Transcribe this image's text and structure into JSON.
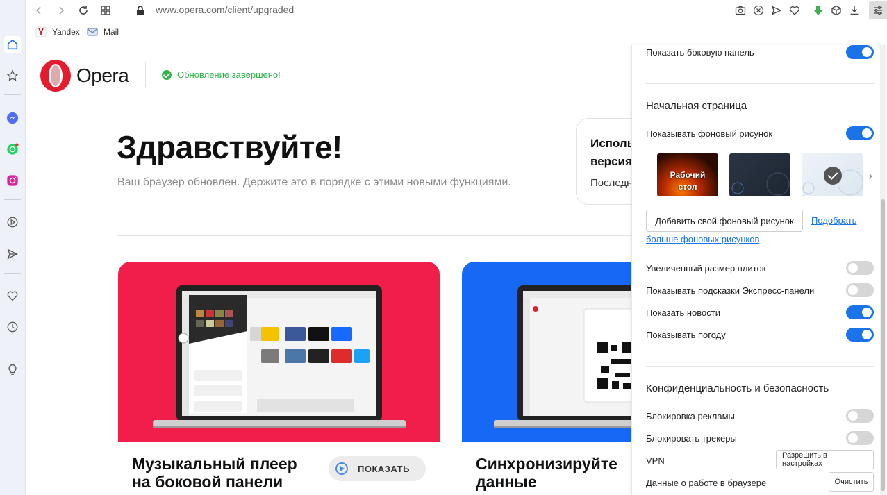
{
  "browser": {
    "url": "www.opera.com/client/upgraded",
    "bookmarks": [
      {
        "label": "Yandex"
      },
      {
        "label": "Mail"
      }
    ]
  },
  "page": {
    "logo_text": "Opera",
    "update_status": "Обновление завершено!",
    "heading": "Здравствуйте!",
    "subheading": "Ваш браузер обновлен. Держите это в порядке с этими новыми функциями.",
    "peek_card": {
      "line1": "Исполь",
      "line2": "версия",
      "line3": "Последн"
    },
    "cards": [
      {
        "title_line1": "Музыкальный плеер",
        "title_line2": "на боковой панели",
        "button": "ПОКАЗАТЬ",
        "color": "#f01e49"
      },
      {
        "title_line1": "Синхронизируйте",
        "title_line2": "данные",
        "color": "#1769f5"
      }
    ]
  },
  "settings": {
    "show_sidebar": {
      "label": "Показать боковую панель",
      "on": true
    },
    "start_page_title": "Начальная страница",
    "show_wallpaper": {
      "label": "Показывать фоновый рисунок",
      "on": true
    },
    "wallpapers": [
      {
        "label_line1": "Рабочий",
        "label_line2": "стол"
      }
    ],
    "add_wallpaper_btn": "Добавить свой фоновый рисунок",
    "more_link_part1": "Подобрать",
    "more_link_part2": "больше фоновых рисунков",
    "toggles": [
      {
        "label": "Увеличенный размер плиток",
        "on": false
      },
      {
        "label": "Показывать подсказки Экспресс-панели",
        "on": false
      },
      {
        "label": "Показать новости",
        "on": true
      },
      {
        "label": "Показывать погоду",
        "on": true
      }
    ],
    "privacy_title": "Конфиденциальность и безопасность",
    "privacy": [
      {
        "label": "Блокировка рекламы",
        "on": false
      },
      {
        "label": "Блокировать трекеры",
        "on": false
      }
    ],
    "vpn": {
      "label": "VPN",
      "button": "Разрешить в настройках"
    },
    "browser_data": {
      "label": "Данные о работе в браузере",
      "button": "Очистить"
    }
  },
  "colors": {
    "accent": "#1a73e8",
    "success": "#2fb34a",
    "opera_red": "#e41d2e"
  }
}
